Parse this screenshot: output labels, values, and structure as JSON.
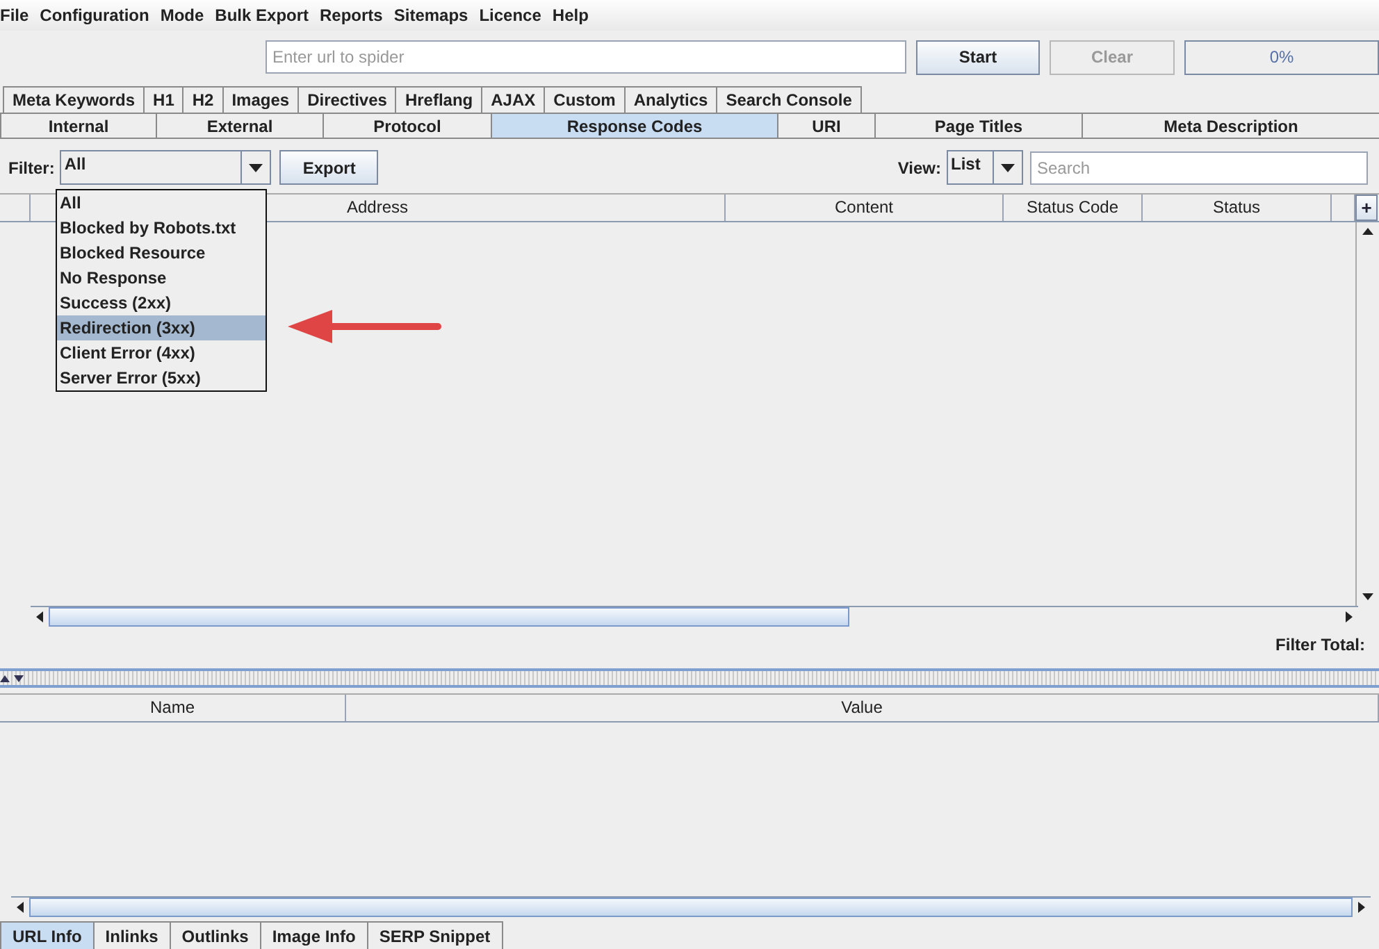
{
  "menu": [
    "File",
    "Configuration",
    "Mode",
    "Bulk Export",
    "Reports",
    "Sitemaps",
    "Licence",
    "Help"
  ],
  "toolbar": {
    "url_placeholder": "Enter url to spider",
    "start": "Start",
    "clear": "Clear",
    "clear_disabled": true,
    "progress": {
      "text": "0%",
      "level": 0
    }
  },
  "tabs_row1": [
    {
      "label": "Meta Keywords",
      "selected": false
    },
    {
      "label": "H1",
      "selected": false
    },
    {
      "label": "H2",
      "selected": false
    },
    {
      "label": "Images",
      "selected": false
    },
    {
      "label": "Directives",
      "selected": false
    },
    {
      "label": "Hreflang",
      "selected": false
    },
    {
      "label": "AJAX",
      "selected": false
    },
    {
      "label": "Custom",
      "selected": false
    },
    {
      "label": "Analytics",
      "selected": false
    },
    {
      "label": "Search Console",
      "selected": false
    }
  ],
  "tabs_row2": [
    {
      "label": "Internal",
      "selected": false
    },
    {
      "label": "External",
      "selected": false
    },
    {
      "label": "Protocol",
      "selected": false
    },
    {
      "label": "Response Codes",
      "selected": true
    },
    {
      "label": "URI",
      "selected": false
    },
    {
      "label": "Page Titles",
      "selected": false
    },
    {
      "label": "Meta Description",
      "selected": false
    }
  ],
  "filter_bar": {
    "filter_label": "Filter:",
    "filter_value": "All",
    "export": "Export",
    "view_label": "View:",
    "view_value": "List",
    "search_placeholder": "Search"
  },
  "filter_dropdown": [
    {
      "label": "All",
      "selected": false
    },
    {
      "label": "Blocked by Robots.txt",
      "selected": false
    },
    {
      "label": "Blocked Resource",
      "selected": false
    },
    {
      "label": "No Response",
      "selected": false
    },
    {
      "label": "Success (2xx)",
      "selected": false
    },
    {
      "label": "Redirection (3xx)",
      "selected": true
    },
    {
      "label": "Client Error (4xx)",
      "selected": false
    },
    {
      "label": "Server Error (5xx)",
      "selected": false
    }
  ],
  "table": {
    "columns": [
      "Address",
      "Content",
      "Status Code",
      "Status"
    ],
    "add_column": "+"
  },
  "filter_total": "Filter Total:",
  "details_table": {
    "columns": [
      "Name",
      "Value"
    ]
  },
  "bottom_tabs": [
    {
      "label": "URL Info",
      "selected": true
    },
    {
      "label": "Inlinks",
      "selected": false
    },
    {
      "label": "Outlinks",
      "selected": false
    },
    {
      "label": "Image Info",
      "selected": false
    },
    {
      "label": "SERP Snippet",
      "selected": false
    }
  ]
}
